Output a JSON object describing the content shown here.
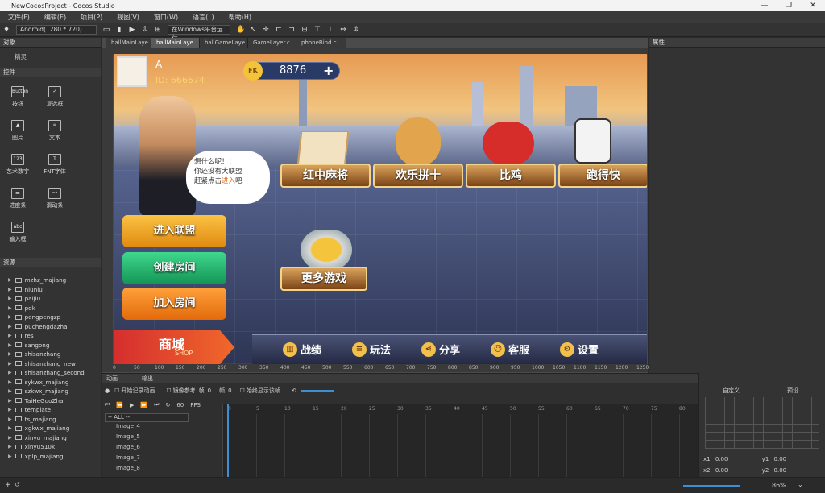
{
  "window": {
    "title": "NewCocosProject - Cocos Studio"
  },
  "menu": [
    "文件(F)",
    "编辑(E)",
    "项目(P)",
    "视图(V)",
    "窗口(W)",
    "语言(L)",
    "帮助(H)"
  ],
  "toolbar": {
    "device": "Android(1280 * 720)",
    "run_target": "在Windows平台运行"
  },
  "left_panel": {
    "title": "对象",
    "sprite": "精灵",
    "controls_title": "控件",
    "widgets": [
      {
        "label": "按钮",
        "icon": "Button"
      },
      {
        "label": "复选框",
        "icon": "✓"
      },
      {
        "label": "图片",
        "icon": "▲"
      },
      {
        "label": "文本",
        "icon": "≡"
      },
      {
        "label": "艺术数字",
        "icon": "123"
      },
      {
        "label": "FNT字体",
        "icon": "T"
      },
      {
        "label": "进度条",
        "icon": "▬"
      },
      {
        "label": "滑动条",
        "icon": "─•"
      },
      {
        "label": "输入框",
        "icon": "abc"
      }
    ]
  },
  "resources": {
    "title": "资源",
    "items": [
      "mzhz_majiang",
      "niuniu",
      "paijiu",
      "pdk",
      "pengpengzp",
      "puchengdazha",
      "res",
      "sangong",
      "shisanzhang",
      "shisanzhang_new",
      "shisanzhang_second",
      "sykwx_majiang",
      "szkwx_majiang",
      "TaiHeGuoZha",
      "template",
      "ts_majiang",
      "xgkwx_majiang",
      "xinyu_majiang",
      "xinyu510k",
      "xplp_majiang"
    ]
  },
  "tabs": [
    "hallMainLaye",
    "hallMainLaye",
    "hallGameLaye",
    "GameLayer.c",
    "phoneBind.c"
  ],
  "ruler_top": [
    "0",
    "50",
    "100",
    "150",
    "200",
    "250",
    "300",
    "350",
    "400",
    "450",
    "500",
    "550",
    "600",
    "650",
    "700",
    "750",
    "800",
    "850",
    "900",
    "950",
    "1000",
    "1050",
    "1100",
    "1150",
    "1200",
    "1250"
  ],
  "game": {
    "player_name": "A",
    "player_id": "ID: 666674",
    "coins": "8876",
    "coin_label": "FK",
    "bubble": [
      "想什么呢！！",
      "你还没有大联盟",
      "赶紧点击",
      "进入",
      "吧"
    ],
    "games": [
      "红中麻将",
      "欢乐拼十",
      "比鸡",
      "跑得快"
    ],
    "more_games": "更多游戏",
    "buttons": [
      "进入联盟",
      "创建房间",
      "加入房间"
    ],
    "shop": "商城",
    "shop_en": "SHOP",
    "bottom": [
      "战绩",
      "玩法",
      "分享",
      "客服",
      "设置"
    ],
    "colors": {
      "join_league": "#f0a21c",
      "create_room": "#20b56c",
      "join_room": "#f07c14"
    }
  },
  "right_panel": {
    "title": "属性"
  },
  "timeline": {
    "tabs": [
      "动画",
      "输出"
    ],
    "record": "开始记录动画",
    "mirror": "镜像参考",
    "frame_label": "帧",
    "frame_value": "0",
    "frame_label2": "帧",
    "frame_value2": "0",
    "always_show": "始终显示该帧",
    "fps": "60",
    "fps_unit": "FPS",
    "filter": "-- ALL --",
    "items": [
      "Image_4",
      "Image_5",
      "Image_6",
      "Image_7",
      "Image_8"
    ],
    "ticks": [
      "0",
      "5",
      "10",
      "15",
      "20",
      "25",
      "30",
      "35",
      "40",
      "45",
      "50",
      "55",
      "60",
      "65",
      "70",
      "75",
      "80"
    ]
  },
  "curve": {
    "tabs": [
      "自定义",
      "预设"
    ],
    "x1": "x1",
    "x1v": "0.00",
    "y1": "y1",
    "y1v": "0.00",
    "x2": "x2",
    "x2v": "0.00",
    "y2": "y2",
    "y2v": "0.00"
  },
  "status": {
    "zoom": "86%"
  }
}
